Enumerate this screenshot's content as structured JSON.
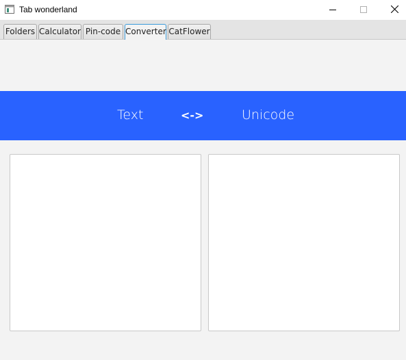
{
  "window": {
    "title": "Tab wonderland"
  },
  "tabs": [
    {
      "label": "Folders",
      "active": false
    },
    {
      "label": "Calculator",
      "active": false
    },
    {
      "label": "Pin-code",
      "active": false
    },
    {
      "label": "Converter",
      "active": true
    },
    {
      "label": "CatFlower",
      "active": false
    }
  ],
  "converter": {
    "left_label": "Text",
    "swap_label": "<->",
    "right_label": "Unicode",
    "banner_color": "#2962ff",
    "left_text": "",
    "right_text": ""
  },
  "icons": {
    "app": "app-window-icon",
    "minimize": "minimize-icon",
    "maximize": "maximize-icon",
    "close": "close-icon"
  }
}
